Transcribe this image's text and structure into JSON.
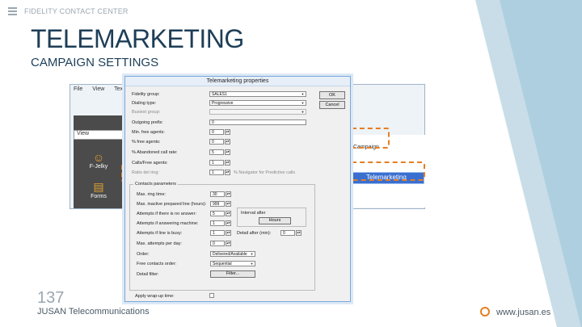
{
  "header": {
    "brand": "FIDELITY CONTACT CENTER"
  },
  "slide": {
    "title": "TELEMARKETING",
    "subtitle": "CAMPAIGN SETTINGS",
    "page_number": "137"
  },
  "footer": {
    "company": "JUSAN Telecommunications",
    "url": "www.jusan.es"
  },
  "background_app": {
    "menu": [
      "File",
      "View",
      "Tex"
    ],
    "view_box": "View",
    "side_items": [
      {
        "label": "F-Jelky",
        "icon": "people-icon"
      },
      {
        "label": "Forms",
        "icon": "form-icon"
      }
    ],
    "list_text": "Campaign",
    "selected_row": "Telemarketing"
  },
  "dialog": {
    "title": "Telemarketing properties",
    "ok_label": "OK",
    "cancel_label": "Cancel",
    "fields": {
      "fidelity_group": {
        "label": "Fidelity group:",
        "value": "SALES1"
      },
      "dialing_type": {
        "label": "Dialing type:",
        "value": "Progressive"
      },
      "busy_group": {
        "label": "Busiest group:",
        "value": ""
      },
      "outgoing_prefix": {
        "label": "Outgoing prefix:",
        "value": "0"
      },
      "min_free_agents": {
        "label": "Min. free agents:",
        "value": "0"
      },
      "num_free_agents": {
        "label": "% free agents:",
        "value": "0"
      },
      "abandoned_call_rate": {
        "label": "% Abandoned call rate:",
        "value": "5"
      },
      "calls_per_free_agent": {
        "label": "Calls/Free agents:",
        "value": "1"
      },
      "predictive_hint": {
        "label": "% Navigator for Predictive calls"
      },
      "rate_label": {
        "label": "Ratio del ring:",
        "value": "1"
      }
    },
    "contacts_group": {
      "title": "Contacts parameters",
      "max_ring_time": {
        "label": "Max. ring time:",
        "value": "30"
      },
      "max_inactive_time": {
        "label": "Max. inactive prepared line (hours):",
        "value": "999"
      },
      "attempts_no_answer": {
        "label": "Attempts if there is no answer:",
        "value": "5"
      },
      "attempts_answering": {
        "label": "Attempts if answering machine:",
        "value": "1"
      },
      "attempts_busy": {
        "label": "Attempts if line is busy:",
        "value": "1"
      },
      "detail_after": {
        "label": "Detail after (min):",
        "value": "0"
      },
      "max_attempts_day": {
        "label": "Max. attempts per day:",
        "value": "0"
      },
      "order": {
        "label": "Order:",
        "value": "Delivered/Available"
      },
      "free_contacts_order": {
        "label": "Free contacts order:",
        "value": "Sequential"
      },
      "detail_filter": {
        "label": "Detail filter:",
        "button": "Filter..."
      },
      "interval_label": "Interval after",
      "interval_button": "Hours"
    },
    "apply_wrap_up": {
      "label": "Apply wrap-up time:"
    }
  },
  "colors": {
    "title": "#1d3e57",
    "accent": "#e67e22",
    "stripe": "#aecfdf",
    "selection": "#3a6fd0"
  }
}
